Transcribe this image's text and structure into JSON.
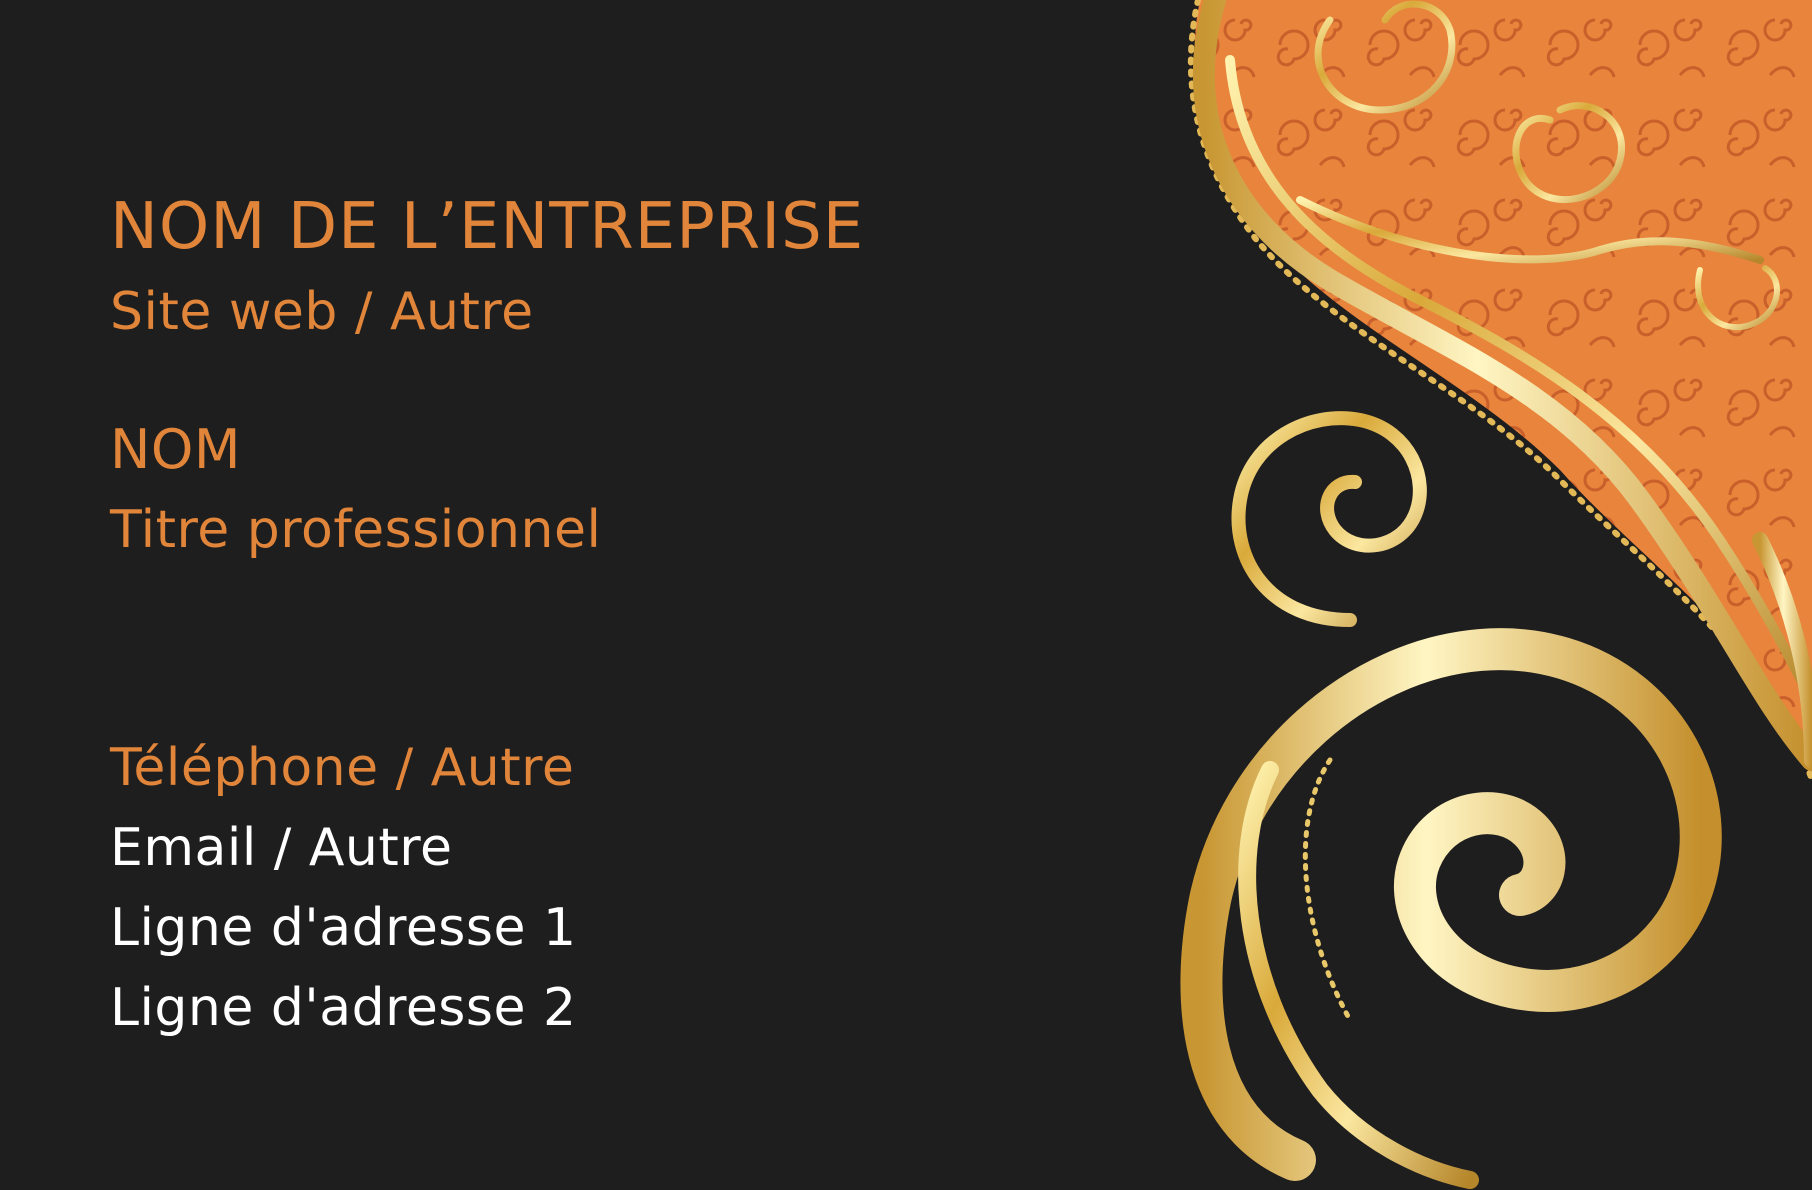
{
  "card": {
    "company_name": "NOM DE L’ENTREPRISE",
    "website": "Site web / Autre",
    "person_name": "NOM",
    "job_title": "Titre professionnel",
    "phone": "Téléphone / Autre",
    "email": "Email / Autre",
    "address_line_1": "Ligne d'adresse 1",
    "address_line_2": "Ligne d'adresse 2"
  },
  "colors": {
    "background": "#1f1e1e",
    "accent_orange": "#e0853a",
    "text_white": "#ffffff",
    "gold": "#d9b24a",
    "pattern_orange": "#e8843c"
  },
  "decoration": {
    "icon": "gold-swirl-ornament-icon"
  }
}
